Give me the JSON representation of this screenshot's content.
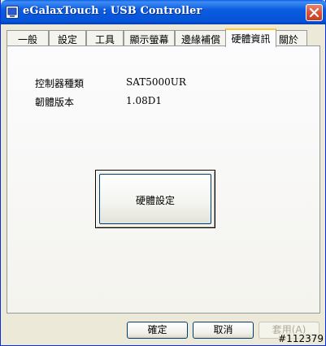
{
  "window": {
    "title": "eGalaxTouch : USB Controller"
  },
  "tabs": [
    {
      "label": "一般"
    },
    {
      "label": "設定"
    },
    {
      "label": "工具"
    },
    {
      "label": "顯示螢幕"
    },
    {
      "label": "邊緣補償"
    },
    {
      "label": "硬體資訊"
    },
    {
      "label": "關於"
    }
  ],
  "active_tab": "硬體資訊",
  "hardware_info": {
    "controller_model_label": "控制器種類",
    "controller_model_value": "SAT5000UR",
    "firmware_version_label": "韌體版本",
    "firmware_version_value": "1.08D1"
  },
  "hardware_settings_button": "硬體設定",
  "footer": {
    "ok": "確定",
    "cancel": "取消",
    "apply": "套用(A)"
  },
  "watermark": "#112379",
  "colors": {
    "titlebar": "#0653d8",
    "active_tab_accent": "#ffc83c",
    "close_button": "#d9533a"
  }
}
